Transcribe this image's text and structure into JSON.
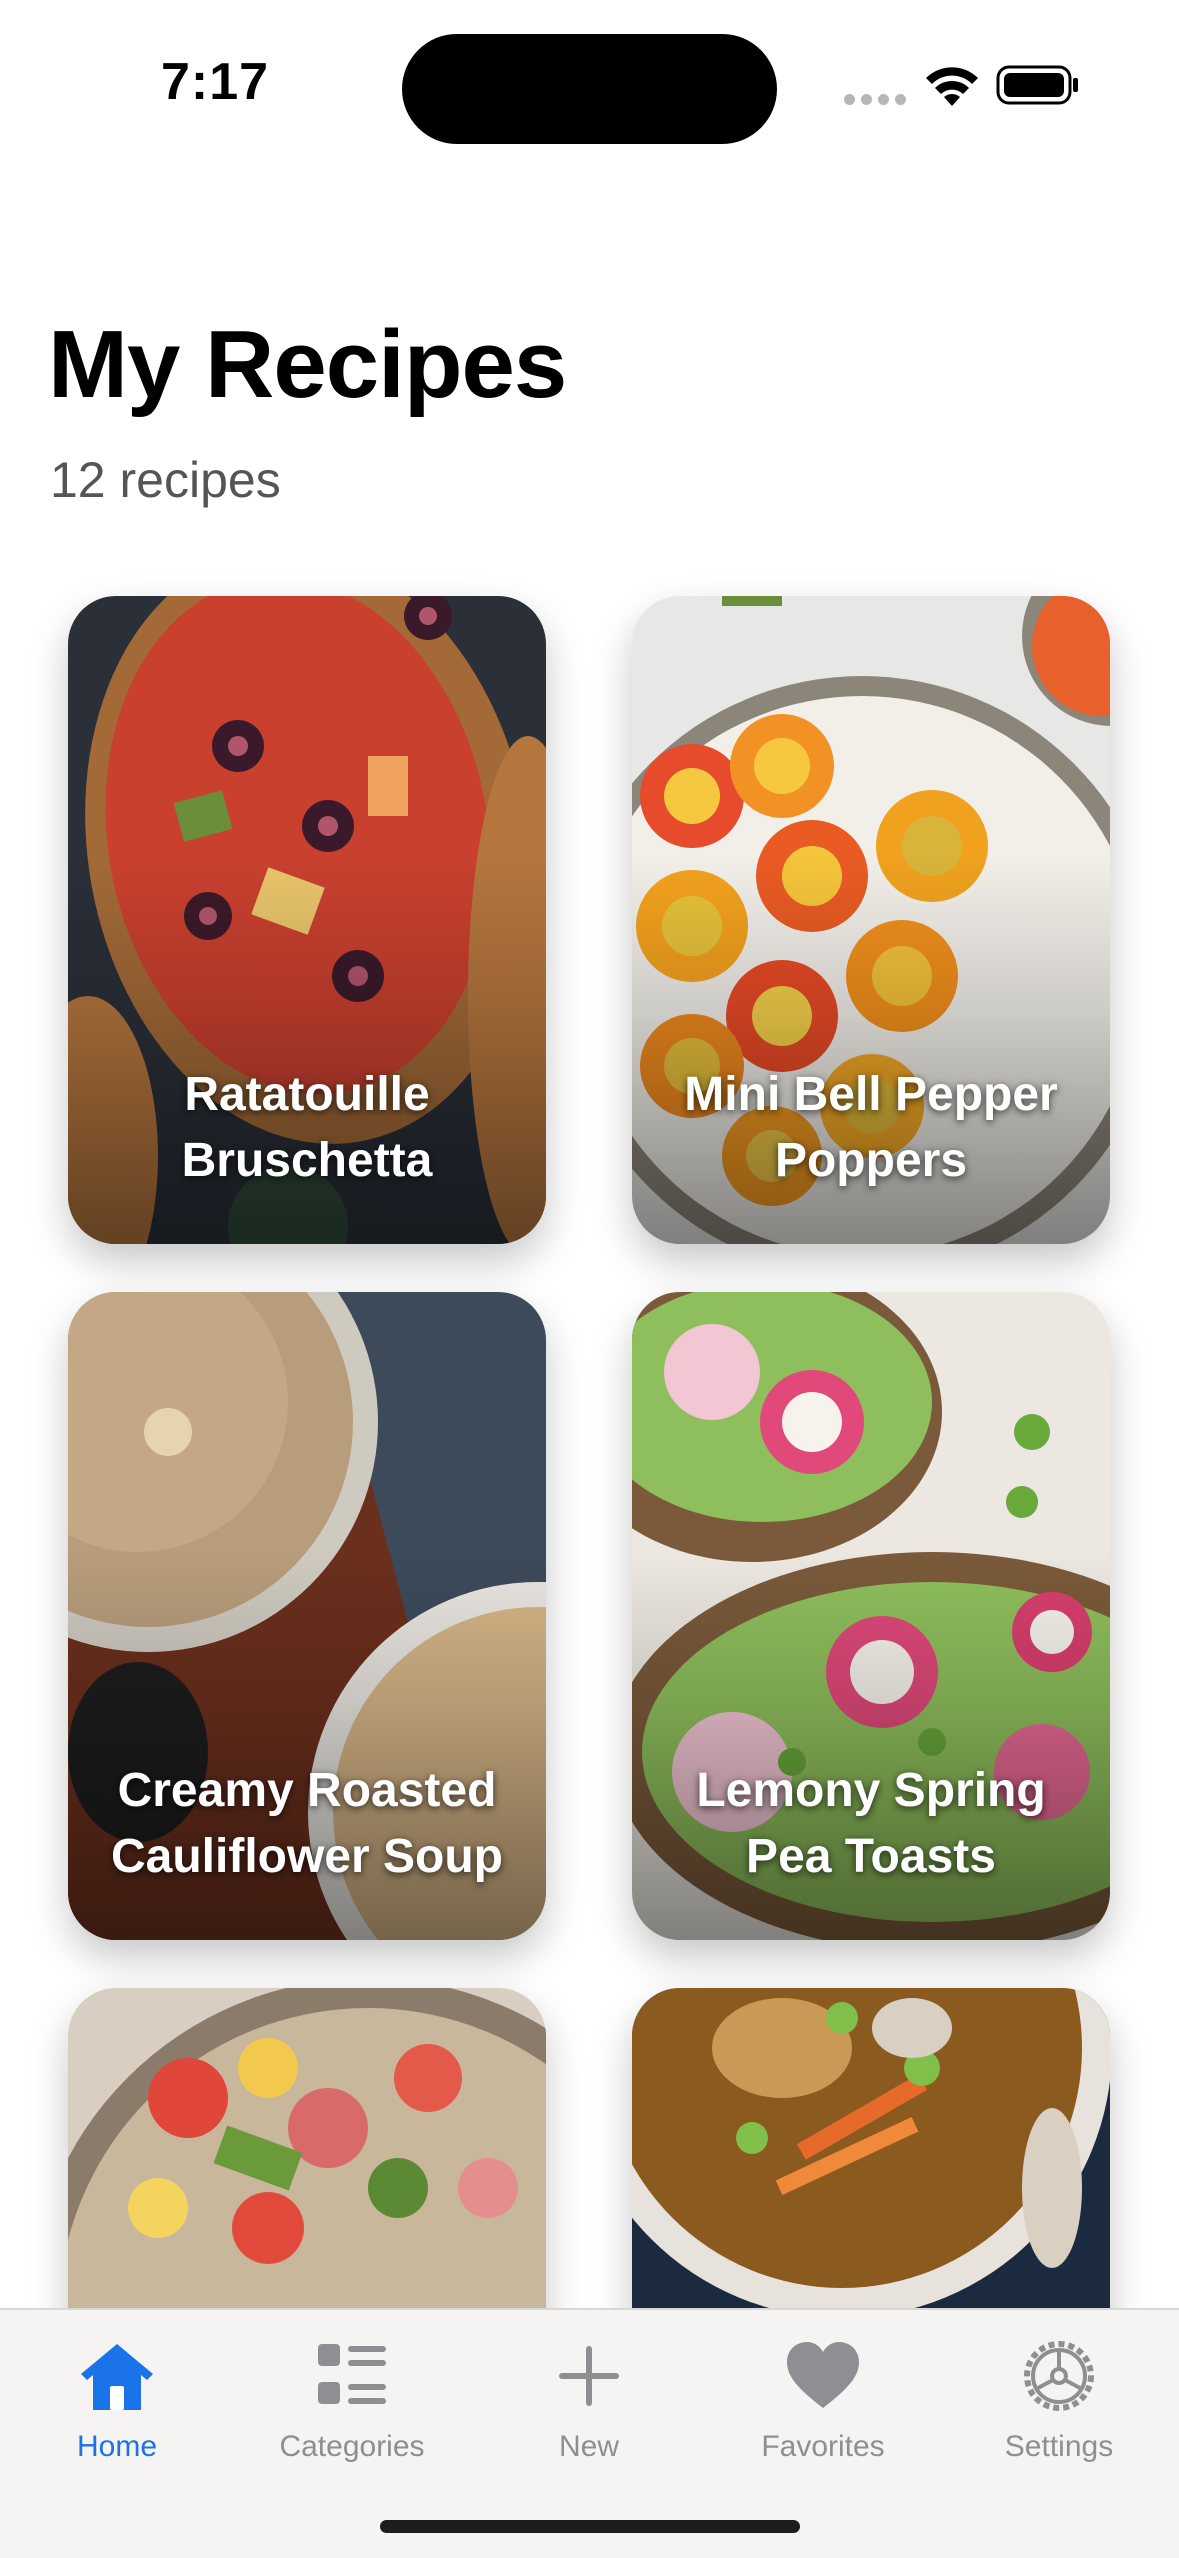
{
  "status_bar": {
    "time": "7:17"
  },
  "header": {
    "title": "My Recipes",
    "subtitle": "12 recipes"
  },
  "recipes": [
    {
      "name": "Ratatouille Bruschetta",
      "line1": "Ratatouille",
      "line2": "Bruschetta"
    },
    {
      "name": "Mini Bell Pepper Poppers",
      "line1": "Mini Bell Pepper",
      "line2": "Poppers"
    },
    {
      "name": "Creamy Roasted Cauliflower Soup",
      "line1": "Creamy Roasted",
      "line2": "Cauliflower Soup"
    },
    {
      "name": "Lemony Spring Pea Toasts",
      "line1": "Lemony Spring",
      "line2": "Pea Toasts"
    },
    {
      "name": "",
      "line1": "",
      "line2": ""
    },
    {
      "name": "",
      "line1": "",
      "line2": ""
    }
  ],
  "tab_bar": {
    "items": [
      {
        "label": "Home",
        "icon": "house-icon",
        "active": true
      },
      {
        "label": "Categories",
        "icon": "list-icon",
        "active": false
      },
      {
        "label": "New",
        "icon": "plus-icon",
        "active": false
      },
      {
        "label": "Favorites",
        "icon": "heart-icon",
        "active": false
      },
      {
        "label": "Settings",
        "icon": "gear-icon",
        "active": false
      }
    ]
  },
  "colors": {
    "accent": "#1a73e8",
    "inactive_tab": "#8e8e93"
  }
}
